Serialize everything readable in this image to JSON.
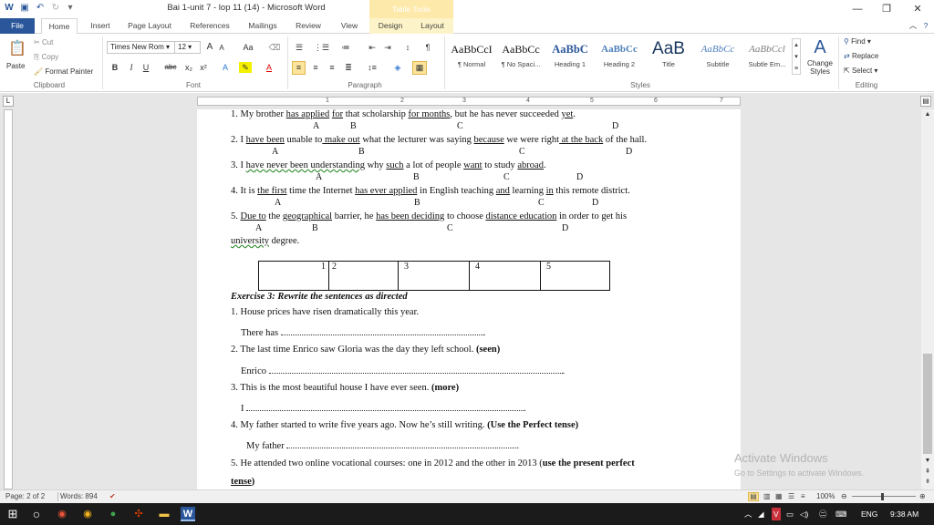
{
  "window": {
    "title": "Bai 1-unit 7 - lop 11 (14) - Microsoft Word",
    "context_tab_group": "Table Tools",
    "minimize": "—",
    "restore": "❐",
    "close": "✕"
  },
  "tabs": [
    "File",
    "Home",
    "Insert",
    "Page Layout",
    "References",
    "Mailings",
    "Review",
    "View",
    "Design",
    "Layout"
  ],
  "ribbon": {
    "clipboard": {
      "paste": "Paste",
      "cut": "Cut",
      "copy": "Copy",
      "format_painter": "Format Painter",
      "label": "Clipboard"
    },
    "font": {
      "name": "Times New Rom",
      "size": "12",
      "bold": "B",
      "italic": "I",
      "underline": "U",
      "strike": "abc",
      "subscript": "x₂",
      "superscript": "x²",
      "grow": "A",
      "shrink": "A",
      "case": "Aa",
      "label": "Font"
    },
    "paragraph": {
      "label": "Paragraph"
    },
    "styles": {
      "label": "Styles",
      "items": [
        {
          "sample": "AaBbCcI",
          "name": "¶ Normal"
        },
        {
          "sample": "AaBbCc",
          "name": "¶ No Spaci..."
        },
        {
          "sample": "AaBbC",
          "name": "Heading 1"
        },
        {
          "sample": "AaBbCc",
          "name": "Heading 2"
        },
        {
          "sample": "AaB",
          "name": "Title"
        },
        {
          "sample": "AaBbCc",
          "name": "Subtitle"
        },
        {
          "sample": "AaBbCcl",
          "name": "Subtle Em..."
        }
      ],
      "change_styles": "Change Styles"
    },
    "editing": {
      "find": "Find",
      "replace": "Replace",
      "select": "Select",
      "label": "Editing"
    }
  },
  "ruler": {
    "numbers": [
      "1",
      "2",
      "3",
      "4",
      "5",
      "6",
      "7"
    ]
  },
  "document": {
    "q1": {
      "text_pre": "1. My brother ",
      "a": "has applied",
      "mid1": " ",
      "b": "for",
      "mid2": " that scholarship ",
      "c": "for months",
      "mid3": ", but he has never succeeded ",
      "d": "yet",
      "end": "."
    },
    "q2": {
      "text_pre": "2. I ",
      "a": "have been",
      "mid1": " unable to",
      "b": " make out",
      "mid2": " what the lecturer was saying ",
      "c": "because",
      "mid3": " we were right",
      "d": " at the back",
      "end": " of the hall."
    },
    "q3": {
      "text_pre": "3. I ",
      "a": "have never been understanding",
      "mid1": " why ",
      "b": "such",
      "mid2": " a lot of people ",
      "c": "want",
      "mid3": " to study ",
      "d": "abroad",
      "end": "."
    },
    "q4": {
      "text_pre": "4. It is ",
      "a": "the first",
      "mid1": " time the Internet ",
      "b": "has ever applied",
      "mid2": " in English teaching ",
      "c": "and",
      "mid3": " learning ",
      "d": "in",
      "end": " this remote district."
    },
    "q5": {
      "text_pre": "5. ",
      "a": "Due to",
      "mid1": " the ",
      "b": "geographical",
      "mid2": " barrier,  he ",
      "c": "has been deciding",
      "mid3": " to choose ",
      "d": "distance education",
      "end": " in  order to get his"
    },
    "q5_cont": {
      "u": "university",
      "rest": " degree."
    },
    "letters": {
      "a": "A",
      "b": "B",
      "c": "C",
      "d": "D"
    },
    "answer_table": [
      "1",
      "2",
      "3",
      "4",
      "5"
    ],
    "exercise3_title": "Exercise 3: Rewrite the sentences  as directed",
    "e1": "1. House prices have risen dramatically this year.",
    "e1_start": "There has",
    "e2": "2. The last time Enrico saw Gloria was the day they left school. ",
    "e2_hint": "(seen)",
    "e2_start": "Enrico",
    "e3": "3. This is the most beautiful house I have ever seen. ",
    "e3_hint": "(more)",
    "e3_start": "I",
    "e4": "4. My father started to write five years ago. Now he’s still writing. ",
    "e4_hint": "(Use the Perfect tense)",
    "e4_start": "My father",
    "e5": "5. He attended two online vocational courses: one in 2012 and the other in 2013 (",
    "e5_hint": "use the present perfect",
    "e5_hint2": "tense",
    "e5_end": ")",
    "dot": "."
  },
  "watermark": {
    "title": "Activate Windows",
    "subtitle": "Go to Settings to activate Windows."
  },
  "status": {
    "page": "Page: 2 of 2",
    "words": "Words: 894",
    "zoom": "100%"
  },
  "taskbar": {
    "lang": "ENG",
    "time": "9:38 AM"
  }
}
